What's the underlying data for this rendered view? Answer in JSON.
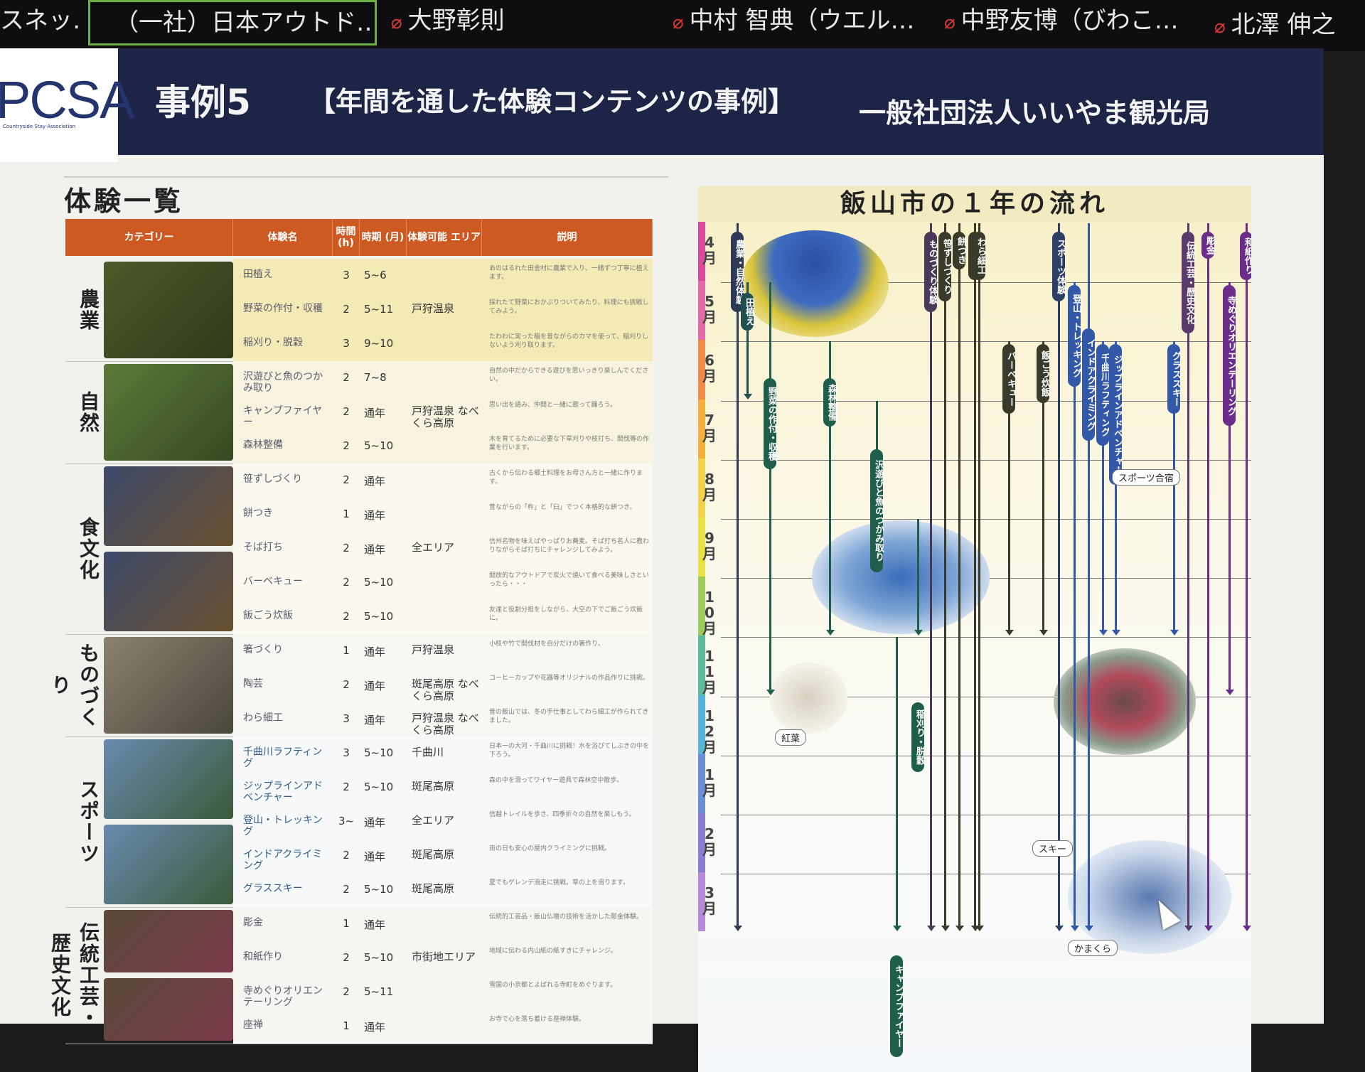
{
  "participants": [
    {
      "name": "スネッ…"
    },
    {
      "name": "（一社）日本アウトド…",
      "active": true
    },
    {
      "name": "大野彰則"
    },
    {
      "name": "中村 智典（ウエル…"
    },
    {
      "name": "中野友博（びわこ…"
    },
    {
      "name": "北澤 伸之"
    }
  ],
  "banner": {
    "logo": "PCSA",
    "logo_sub": "Countryside Stay Association",
    "case": "事例5",
    "theme": "【年間を通した体験コンテンツの事例】",
    "org": "一般社団法人いいやま観光局"
  },
  "list": {
    "title": "体験一覧",
    "headers": [
      "カテゴリー",
      "体験名",
      "時間 (h)",
      "時期 (月)",
      "体験可能 エリア",
      "説明"
    ],
    "categories": [
      "農業",
      "自然",
      "食文化",
      "ものづくり",
      "スポーツ",
      "伝統工芸・歴史文化"
    ],
    "rows": [
      {
        "name": "田植え",
        "hours": "3",
        "period": "5~6",
        "area": "",
        "desc": "あのはるれた田舎村に農業で入り、一緒ずつ丁寧に植えます。"
      },
      {
        "name": "野菜の作付・収穫",
        "hours": "2",
        "period": "5~11",
        "area": "戸狩温泉",
        "desc": "採れたて野菜におかぶりついてみたり、料理にも挑戦してみよう。"
      },
      {
        "name": "稲刈り・脱穀",
        "hours": "3",
        "period": "9~10",
        "area": "",
        "desc": "たわわに実った稲を昔ながらのカマを使って、稲刈りしないよう刈り取ります。"
      },
      {
        "name": "沢遊びと魚のつかみ取り",
        "hours": "2",
        "period": "7~8",
        "area": "",
        "desc": "自然の中だからできる遊びを思いっきり楽しんでください。"
      },
      {
        "name": "キャンプファイヤー",
        "hours": "2",
        "period": "通年",
        "area": "戸狩温泉 なべくら高原",
        "desc": "思い出を語み、仲間と一緒に歌って踊ろう。"
      },
      {
        "name": "森林整備",
        "hours": "2",
        "period": "5~10",
        "area": "",
        "desc": "木を育てるために必要な下草刈りや枝打ち、間伐等の作業を行います。"
      },
      {
        "name": "笹ずしづくり",
        "hours": "2",
        "period": "通年",
        "area": "",
        "desc": "古くから伝わる郷土料理をお母さん方と一緒に作ります。"
      },
      {
        "name": "餅つき",
        "hours": "1",
        "period": "通年",
        "area": "",
        "desc": "昔ながらの「杵」と「臼」でつく本格的な餅つき。"
      },
      {
        "name": "そば打ち",
        "hours": "2",
        "period": "通年",
        "area": "全エリア",
        "desc": "信州名物を味えばやっぱりお蕎麦。そば打ち名人に教わりながらそば打ちにチャレンジしてみよう。"
      },
      {
        "name": "バーベキュー",
        "hours": "2",
        "period": "5~10",
        "area": "",
        "desc": "開放的なアウトドアで炭火で焼いて食べる美味しさといったら・・・"
      },
      {
        "name": "飯ごう炊飯",
        "hours": "2",
        "period": "5~10",
        "area": "",
        "desc": "友達と役割分担をしながら、大空の下でご飯ごう炊飯に。"
      },
      {
        "name": "箸づくり",
        "hours": "1",
        "period": "通年",
        "area": "戸狩温泉",
        "desc": "小枝や竹で間伐材を自分だけの箸作り。"
      },
      {
        "name": "陶芸",
        "hours": "2",
        "period": "通年",
        "area": "斑尾高原 なべくら高原",
        "desc": "コーヒーカップや花器等オリジナルの作品作りに挑戦。"
      },
      {
        "name": "わら細工",
        "hours": "3",
        "period": "通年",
        "area": "戸狩温泉 なべくら高原",
        "desc": "昔の飯山では、冬の手仕事としてわら細工が作られてきました。"
      },
      {
        "name": "千曲川ラフティング",
        "hours": "3",
        "period": "5~10",
        "area": "千曲川",
        "desc": "日本一の大河・千曲川に挑戦！水を浴びてしぶきの中を下ろう。"
      },
      {
        "name": "ジップラインアドベンチャー",
        "hours": "2",
        "period": "5~10",
        "area": "斑尾高原",
        "desc": "森の中を滑ってワイヤー遊具で森林空中散歩。"
      },
      {
        "name": "登山・トレッキング",
        "hours": "3~",
        "period": "通年",
        "area": "全エリア",
        "desc": "信越トレイルを歩き、四季折々の自然を楽しもう。"
      },
      {
        "name": "インドアクライミング",
        "hours": "2",
        "period": "通年",
        "area": "斑尾高原",
        "desc": "雨の日も安心の屋内クライミングに挑戦。"
      },
      {
        "name": "グラススキー",
        "hours": "2",
        "period": "5~10",
        "area": "斑尾高原",
        "desc": "夏でもゲレンデ滑走に挑戦。草の上を滑ります。"
      },
      {
        "name": "彫金",
        "hours": "1",
        "period": "通年",
        "area": "",
        "desc": "伝統的工芸品・飯山仏壇の技術を活かした彫金体験。"
      },
      {
        "name": "和紙作り",
        "hours": "2",
        "period": "5~10",
        "area": "市街地エリア",
        "desc": "地域に伝わる内山紙の紙すきにチャレンジ。"
      },
      {
        "name": "寺めぐりオリエンテーリング",
        "hours": "2",
        "period": "5~11",
        "area": "",
        "desc": "雪国の小京都とよばれる寺町をめぐります。"
      },
      {
        "name": "座禅",
        "hours": "1",
        "period": "通年",
        "area": "",
        "desc": "お寺で心を落ち着ける座禅体験。"
      }
    ]
  },
  "chart_data": {
    "type": "table",
    "title": "飯山市の１年の流れ",
    "months": [
      "4月",
      "5月",
      "6月",
      "7月",
      "8月",
      "9月",
      "10月",
      "11月",
      "12月",
      "1月",
      "2月",
      "3月"
    ],
    "activities": [
      {
        "name": "農業・自然体験",
        "color": "#2e3a55",
        "start_month": "4月",
        "end_month": "3月"
      },
      {
        "name": "田植え",
        "color": "#1f4f4f",
        "start_month": "5月",
        "end_month": "6月"
      },
      {
        "name": "野菜の作付・収穫",
        "color": "#1f5e4a",
        "start_month": "5月",
        "end_month": "11月"
      },
      {
        "name": "森林整備",
        "color": "#1f5e4a",
        "start_month": "6月",
        "end_month": "10月"
      },
      {
        "name": "沢遊びと魚のつかみ取り",
        "color": "#1f5e4a",
        "start_month": "7月",
        "end_month": "8月"
      },
      {
        "name": "キャンプファイヤー",
        "color": "#1f5e4a",
        "start_month": "11月",
        "end_month": "3月"
      },
      {
        "name": "稲刈り・脱穀",
        "color": "#1f5e4a",
        "start_month": "9月",
        "end_month": "10月"
      },
      {
        "name": "ものづくり体験",
        "color": "#4a3a5a",
        "start_month": "4月",
        "end_month": "3月"
      },
      {
        "name": "笹ずしづくり",
        "color": "#3a3a2a",
        "start_month": "4月",
        "end_month": "3月"
      },
      {
        "name": "餅つき",
        "color": "#3a3a2a",
        "start_month": "4月",
        "end_month": "3月"
      },
      {
        "name": "そば打ち",
        "color": "#3a3a2a",
        "start_month": "4月",
        "end_month": "3月"
      },
      {
        "name": "わら細工",
        "color": "#3a3a2a",
        "start_month": "4月",
        "end_month": "3月"
      },
      {
        "name": "バーベキュー",
        "color": "#3a3a2a",
        "start_month": "6月",
        "end_month": "10月"
      },
      {
        "name": "飯ごう炊飯",
        "color": "#3a3a2a",
        "start_month": "6月",
        "end_month": "10月"
      },
      {
        "name": "スポーツ体験",
        "color": "#2c3f66",
        "start_month": "4月",
        "end_month": "3月"
      },
      {
        "name": "登山・トレッキング",
        "color": "#3458a8",
        "start_month": "5月",
        "end_month": "3月"
      },
      {
        "name": "インドアクライミング",
        "color": "#3458a8",
        "start_month": "4月",
        "end_month": "3月"
      },
      {
        "name": "千曲川ラフティング",
        "color": "#3458a8",
        "start_month": "6月",
        "end_month": "10月"
      },
      {
        "name": "ジップラインアドベンチャー",
        "color": "#3458a8",
        "start_month": "6月",
        "end_month": "10月"
      },
      {
        "name": "グラススキー",
        "color": "#3458a8",
        "start_month": "6月",
        "end_month": "10月"
      },
      {
        "name": "伝統工芸・歴史文化",
        "color": "#5a3a6a",
        "start_month": "4月",
        "end_month": "3月"
      },
      {
        "name": "彫金",
        "color": "#6a2e8a",
        "start_month": "4月",
        "end_month": "3月"
      },
      {
        "name": "和紙作り",
        "color": "#6a2e8a",
        "start_month": "4月",
        "end_month": "3月"
      },
      {
        "name": "寺めぐりオリエンテーリング",
        "color": "#6a2e8a",
        "start_month": "5月",
        "end_month": "11月"
      }
    ],
    "labels": [
      "スポーツ合宿",
      "スキー",
      "かまくら",
      "紅葉"
    ]
  }
}
